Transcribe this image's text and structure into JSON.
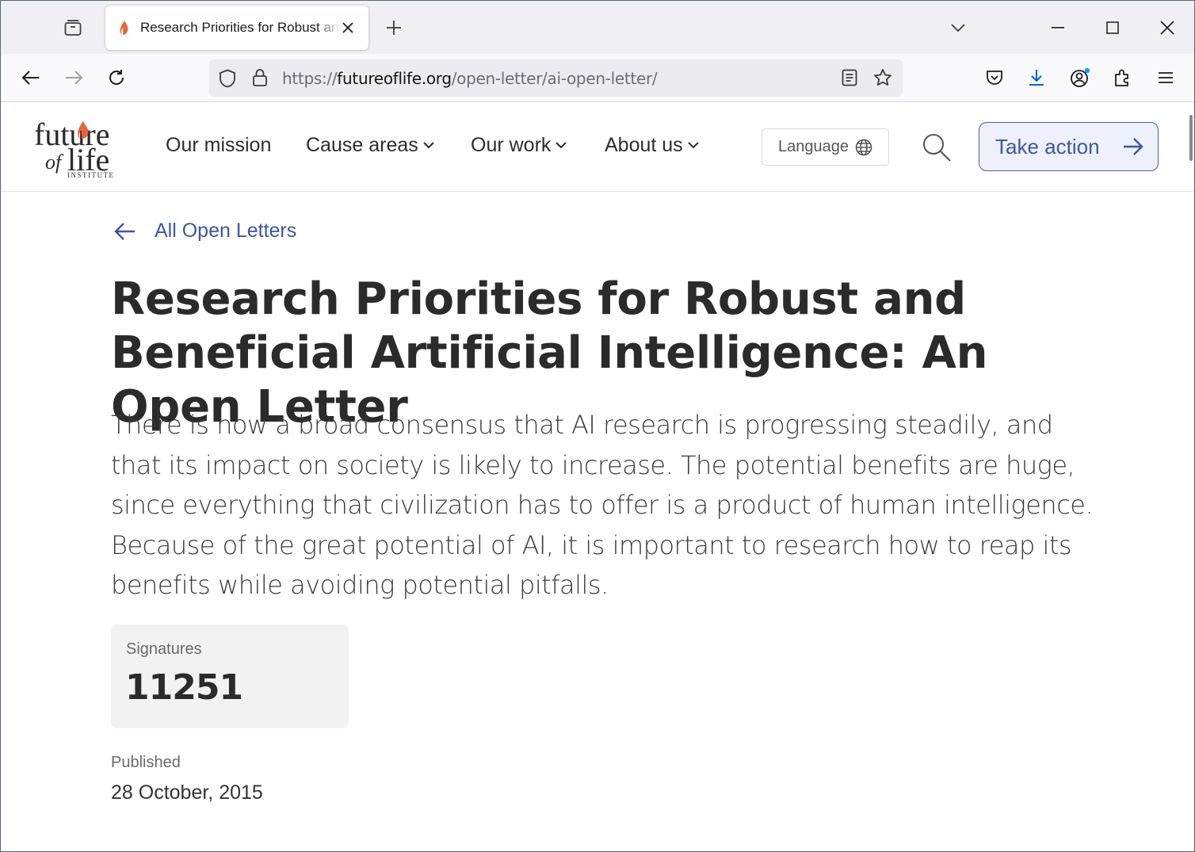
{
  "browser": {
    "tab": {
      "title": "Research Priorities for Robust and Beneficial Artificial Intelligence: An Open Letter"
    },
    "url": {
      "scheme": "https://",
      "host": "futureoflife.org",
      "path": "/open-letter/ai-open-letter/"
    },
    "colors": {
      "accent": "#0060df",
      "download_dot": "#00a3ff"
    }
  },
  "site": {
    "logo": {
      "line1": "future",
      "line2a": "of",
      "line2b": "life",
      "line3": "INSTITUTE",
      "flame_color": "#e8643a"
    },
    "nav": {
      "mission": "Our mission",
      "cause_areas": "Cause areas",
      "our_work": "Our work",
      "about_us": "About us"
    },
    "language_label": "Language",
    "take_action_label": "Take action",
    "accent_color": "#3e56a3"
  },
  "article": {
    "back_link": "All Open Letters",
    "title": "Research Priorities for Robust and Beneficial Artificial Intelligence: An Open Letter",
    "intro": "There is now a broad consensus that AI research is progressing steadily, and that its impact on society is likely to increase. The potential benefits are huge, since everything that civilization has to offer is a product of human intelligence. Because of the great potential of AI, it is important to research how to reap its benefits while avoiding potential pitfalls.",
    "signatures_label": "Signatures",
    "signatures_value": "11251",
    "published_label": "Published",
    "published_date": "28 October, 2015"
  }
}
